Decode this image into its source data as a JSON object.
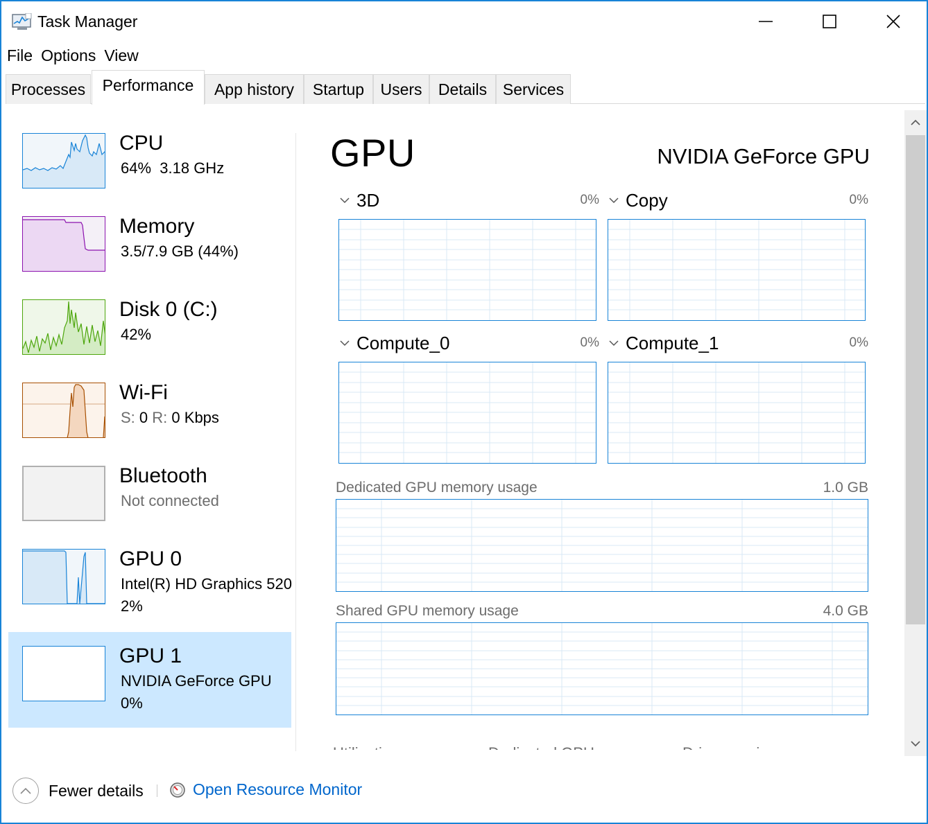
{
  "window": {
    "title": "Task Manager",
    "icons": {
      "app": "task-manager-icon",
      "minimize": "minimize-icon",
      "maximize": "maximize-icon",
      "close": "close-icon"
    }
  },
  "menu": [
    "File",
    "Options",
    "View"
  ],
  "tabs": [
    "Processes",
    "Performance",
    "App history",
    "Startup",
    "Users",
    "Details",
    "Services"
  ],
  "active_tab": "Performance",
  "nav": [
    {
      "title": "CPU",
      "sub": "64%  3.18 GHz",
      "color": "#1883d7",
      "fill": "#f1f6fa"
    },
    {
      "title": "Memory",
      "sub": "3.5/7.9 GB (44%)",
      "color": "#8b12ae",
      "fill": "#f4f0f7"
    },
    {
      "title": "Disk 0 (C:)",
      "sub": "42%",
      "color": "#4da60c",
      "fill": "#eff7e9"
    },
    {
      "title": "Wi-Fi",
      "sub_s_label": "S:",
      "sub_s_value": "0",
      "sub_r_label": "R:",
      "sub_r_value": "0 Kbps",
      "color": "#a74f01",
      "fill": "#fcf3eb"
    },
    {
      "title": "Bluetooth",
      "sub": "Not connected",
      "color": "#b0b0b0",
      "fill": "#f2f2f2"
    },
    {
      "title": "GPU 0",
      "sub": "Intel(R) HD Graphics 520",
      "sub2": "2%",
      "color": "#1883d7",
      "fill": "#f1f6fa"
    },
    {
      "title": "GPU 1",
      "sub": "NVIDIA GeForce GPU",
      "sub2": "0%",
      "color": "#1883d7",
      "fill": "#ffffff",
      "selected": true
    }
  ],
  "main": {
    "title": "GPU",
    "device": "NVIDIA GeForce GPU",
    "engines": [
      {
        "name": "3D",
        "pct": "0%"
      },
      {
        "name": "Copy",
        "pct": "0%"
      },
      {
        "name": "Compute_0",
        "pct": "0%"
      },
      {
        "name": "Compute_1",
        "pct": "0%"
      }
    ],
    "dedicated": {
      "label": "Dedicated GPU memory usage",
      "value": "1.0 GB"
    },
    "shared": {
      "label": "Shared GPU memory usage",
      "value": "4.0 GB"
    },
    "stats": [
      "Utilization",
      "Dedicated GPU memory",
      "Driver version:"
    ]
  },
  "footer": {
    "fewer_details": "Fewer details",
    "open_resource_monitor": "Open Resource Monitor"
  },
  "colors": {
    "accent": "#1883d7",
    "selected_bg": "#cce8ff",
    "link": "#0066cc"
  }
}
